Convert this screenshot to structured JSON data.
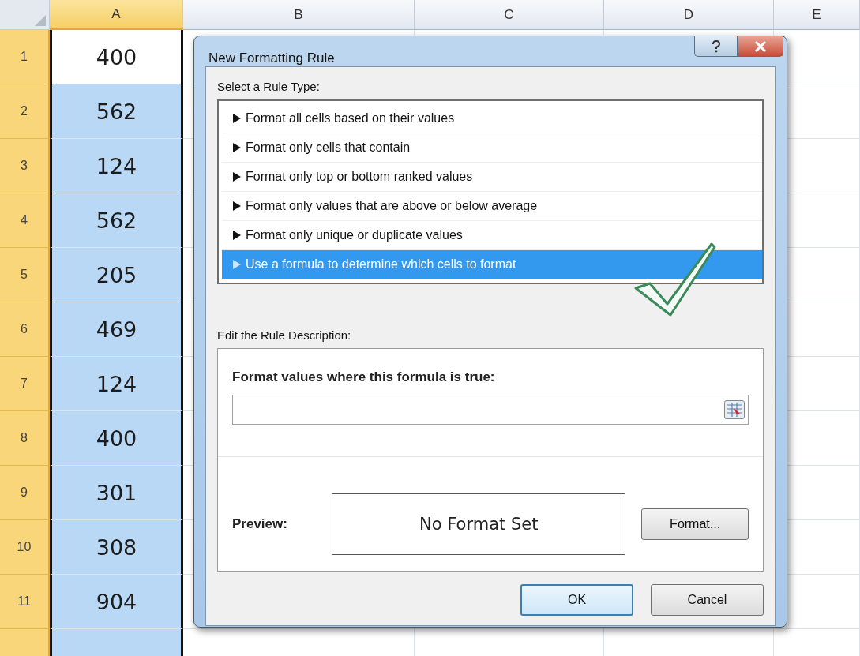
{
  "columns": [
    {
      "label": "A",
      "selected": true
    },
    {
      "label": "B",
      "selected": false
    },
    {
      "label": "C",
      "selected": false
    },
    {
      "label": "D",
      "selected": false
    },
    {
      "label": "E",
      "selected": false
    }
  ],
  "rows": [
    {
      "number": "1",
      "value": "400",
      "selected": true,
      "active": true
    },
    {
      "number": "2",
      "value": "562",
      "selected": true,
      "active": false
    },
    {
      "number": "3",
      "value": "124",
      "selected": true,
      "active": false
    },
    {
      "number": "4",
      "value": "562",
      "selected": true,
      "active": false
    },
    {
      "number": "5",
      "value": "205",
      "selected": true,
      "active": false
    },
    {
      "number": "6",
      "value": "469",
      "selected": true,
      "active": false
    },
    {
      "number": "7",
      "value": "124",
      "selected": true,
      "active": false
    },
    {
      "number": "8",
      "value": "400",
      "selected": true,
      "active": false
    },
    {
      "number": "9",
      "value": "301",
      "selected": true,
      "active": false
    },
    {
      "number": "10",
      "value": "308",
      "selected": true,
      "active": false
    },
    {
      "number": "11",
      "value": "904",
      "selected": true,
      "active": false
    }
  ],
  "dialog": {
    "title": "New Formatting Rule",
    "rule_type_label": "Select a Rule Type:",
    "rule_types": [
      {
        "label": "Format all cells based on their values",
        "selected": false
      },
      {
        "label": "Format only cells that contain",
        "selected": false
      },
      {
        "label": "Format only top or bottom ranked values",
        "selected": false
      },
      {
        "label": "Format only values that are above or below average",
        "selected": false
      },
      {
        "label": "Format only unique or duplicate values",
        "selected": false
      },
      {
        "label": "Use a formula to determine which cells to format",
        "selected": true
      }
    ],
    "description_label": "Edit the Rule Description:",
    "formula_label": "Format values where this formula is true:",
    "preview_label": "Preview:",
    "preview_text": "No Format Set",
    "format_button": "Format...",
    "ok_button": "OK",
    "cancel_button": "Cancel"
  }
}
